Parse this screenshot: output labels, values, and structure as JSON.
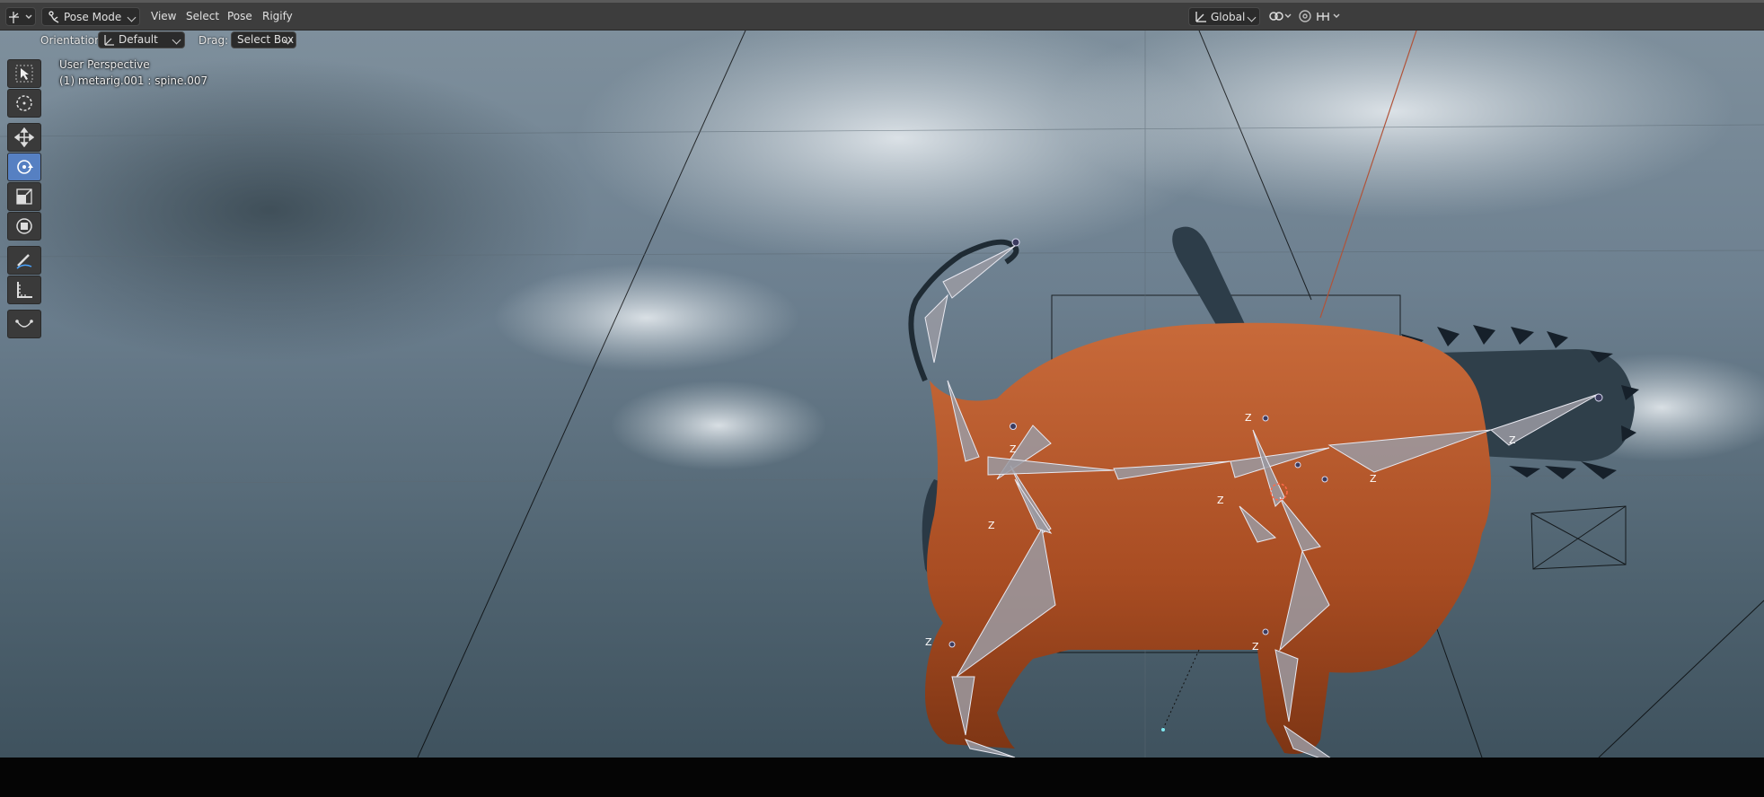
{
  "header": {
    "editor_type_icon": "viewport-editor-icon",
    "mode": "Pose Mode",
    "menus": [
      "View",
      "Select",
      "Pose",
      "Rigify"
    ],
    "transform_orientation": "Global",
    "snap_icon": "link-icon",
    "proportional_icon": "proportional-icon",
    "options_icon": "options-icon"
  },
  "tool_options": {
    "orientation_label": "Orientation:",
    "orientation_value": "Default",
    "drag_label": "Drag:",
    "drag_value": "Select Box"
  },
  "viewport": {
    "perspective": "User Perspective",
    "active_object": "(1) metarig.001 : spine.007"
  },
  "toolbar": {
    "tools": [
      {
        "name": "select-box-tool",
        "icon": "cursor-arrow-icon",
        "active": false
      },
      {
        "name": "cursor-tool",
        "icon": "crosshair-circle-icon",
        "active": false
      },
      {
        "name": "move-tool",
        "icon": "move-arrows-icon",
        "active": false
      },
      {
        "name": "rotate-tool",
        "icon": "rotate-icon",
        "active": true
      },
      {
        "name": "scale-tool",
        "icon": "scale-icon",
        "active": false
      },
      {
        "name": "transform-tool",
        "icon": "transform-icon",
        "active": false
      },
      {
        "name": "annotate-tool",
        "icon": "pencil-icon",
        "active": false
      },
      {
        "name": "measure-tool",
        "icon": "ruler-icon",
        "active": false
      },
      {
        "name": "bone-curve-tool",
        "icon": "curve-icon",
        "active": false
      }
    ]
  },
  "colors": {
    "header_bg": "#3d3d3d",
    "active_tool": "#5680c2",
    "body_orange": "#b9582c",
    "dark_tube": "#2f3f4a",
    "bone_gray": "#9a9aa2"
  }
}
